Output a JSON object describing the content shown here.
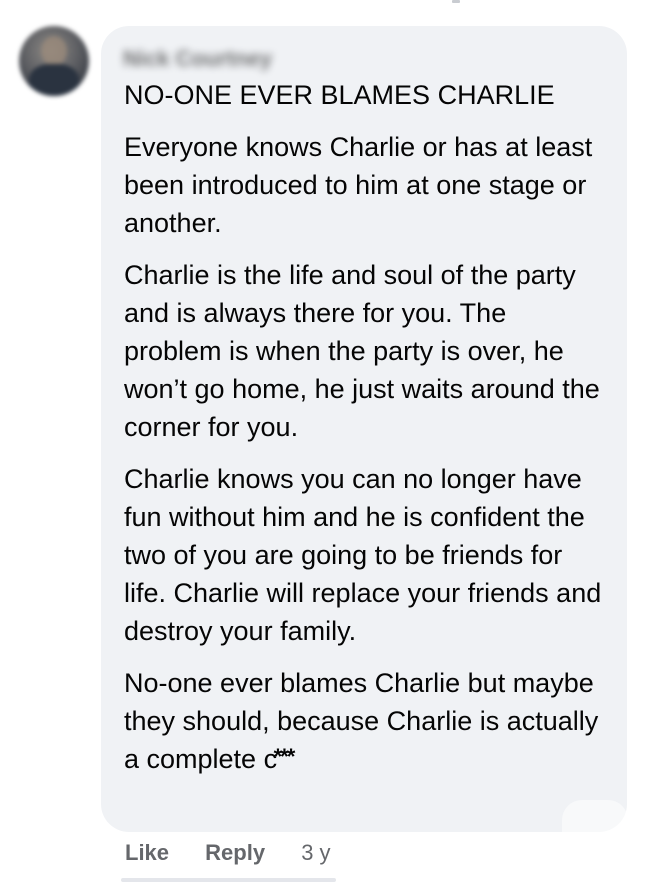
{
  "comment": {
    "author_name": "Nick Courtney",
    "heading": "NO-ONE EVER BLAMES CHARLIE",
    "paragraphs": [
      "Everyone knows Charlie or has at least been introduced to him at one stage or another.",
      "Charlie is the life and soul of the party and is always there for you. The problem is when the party is over, he won’t go home, he just waits around the corner for you.",
      "Charlie knows you can no longer have fun without him and he is confident the two of you are going to be friends for life. Charlie will replace your friends and destroy your family."
    ],
    "last_paragraph_text": "No-one ever blames Charlie but maybe they should, because Charlie is actually a complete ",
    "censored_word_start": "c",
    "censored_mask": "***"
  },
  "actions": {
    "like_label": "Like",
    "reply_label": "Reply",
    "timestamp": "3 y"
  },
  "colors": {
    "bubble_bg": "#f0f2f5",
    "text": "#050505",
    "secondary_text": "#65676b"
  }
}
